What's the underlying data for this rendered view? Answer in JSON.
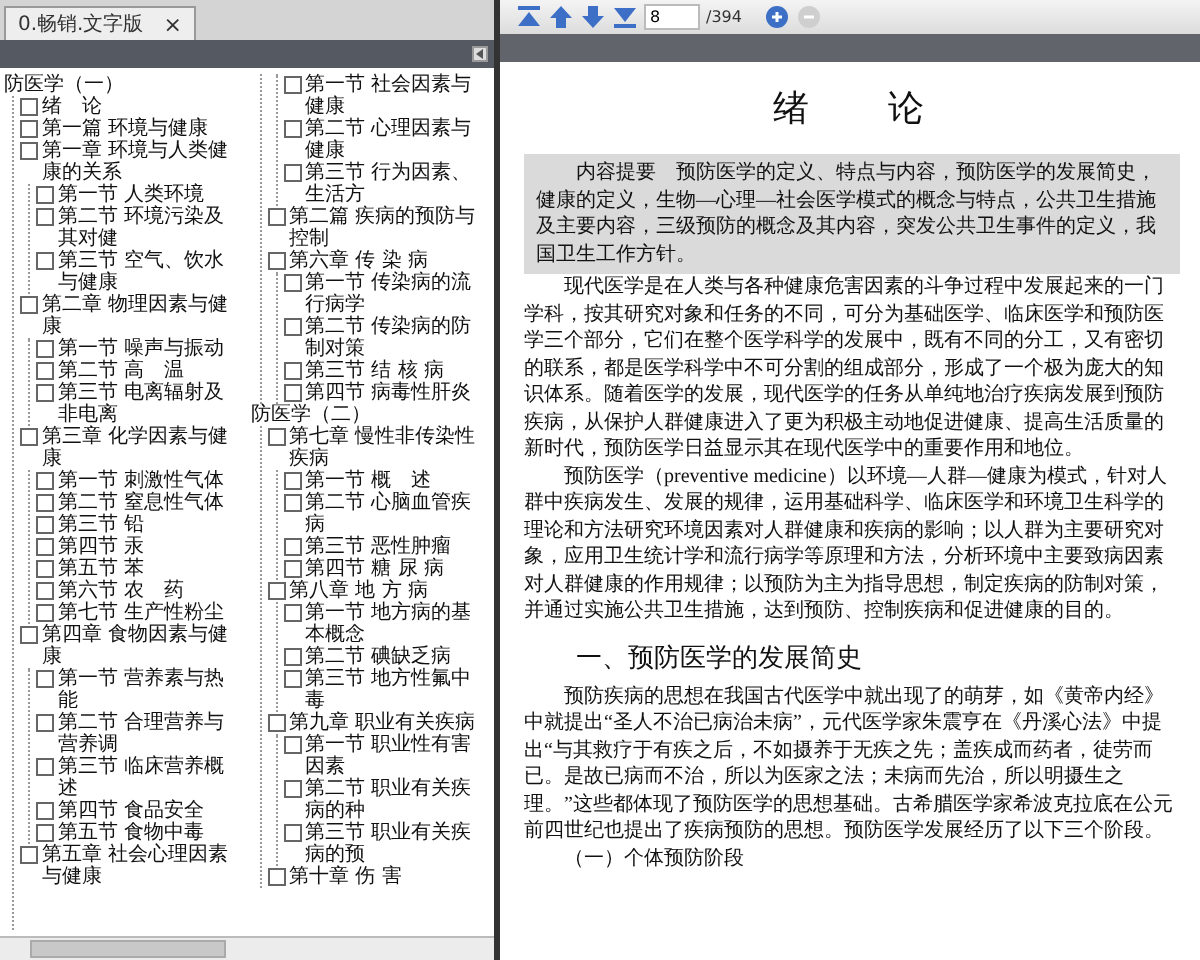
{
  "tab": {
    "label": "0.畅销.文字版",
    "close": "×"
  },
  "toolbar": {
    "page": "8",
    "total": "/394"
  },
  "sidebar": {
    "tree": [
      {
        "label": "防医学（一）",
        "children": [
          {
            "label": "绪　论",
            "checked": false
          },
          {
            "label": "第一篇 环境与健康",
            "checked": false
          },
          {
            "label": "第一章 环境与人类健康的关系",
            "checked": false,
            "children": [
              {
                "label": "第一节 人类环境",
                "checked": false
              },
              {
                "label": "第二节 环境污染及其对健",
                "checked": false
              },
              {
                "label": "第三节 空气、饮水与健康",
                "checked": false
              }
            ]
          },
          {
            "label": "第二章 物理因素与健康",
            "checked": false,
            "children": [
              {
                "label": "第一节 噪声与振动",
                "checked": false
              },
              {
                "label": "第二节 高　温",
                "checked": false
              },
              {
                "label": "第三节 电离辐射及非电离",
                "checked": false
              }
            ]
          },
          {
            "label": "第三章 化学因素与健康",
            "checked": false,
            "children": [
              {
                "label": "第一节 刺激性气体",
                "checked": false
              },
              {
                "label": "第二节 窒息性气体",
                "checked": false
              },
              {
                "label": "第三节 铅",
                "checked": false
              },
              {
                "label": "第四节 汞",
                "checked": false
              },
              {
                "label": "第五节 苯",
                "checked": false
              },
              {
                "label": "第六节 农　药",
                "checked": false
              },
              {
                "label": "第七节 生产性粉尘",
                "checked": false
              }
            ]
          },
          {
            "label": "第四章 食物因素与健康",
            "checked": false,
            "children": [
              {
                "label": "第一节 营养素与热能",
                "checked": false
              },
              {
                "label": "第二节 合理营养与营养调",
                "checked": false
              },
              {
                "label": "第三节 临床营养概述",
                "checked": false
              },
              {
                "label": "第四节 食品安全",
                "checked": false
              },
              {
                "label": "第五节 食物中毒",
                "checked": false
              }
            ]
          },
          {
            "label": "第五章 社会心理因素与健康",
            "checked": false,
            "children": [
              {
                "label": "第一节 社会因素与健康",
                "checked": false
              },
              {
                "label": "第二节 心理因素与健康",
                "checked": false
              },
              {
                "label": "第三节 行为因素、生活方",
                "checked": false
              }
            ]
          },
          {
            "label": "第二篇 疾病的预防与控制",
            "checked": false
          },
          {
            "label": "第六章 传 染 病",
            "checked": false,
            "children": [
              {
                "label": "第一节 传染病的流行病学",
                "checked": false
              },
              {
                "label": "第二节 传染病的防制对策",
                "checked": false
              },
              {
                "label": "第三节 结 核 病",
                "checked": false
              },
              {
                "label": "第四节 病毒性肝炎",
                "checked": false
              }
            ]
          }
        ]
      },
      {
        "label": "防医学（二）",
        "children": [
          {
            "label": "第七章 慢性非传染性疾病",
            "checked": false,
            "children": [
              {
                "label": "第一节 概　述",
                "checked": false
              },
              {
                "label": "第二节 心脑血管疾病",
                "checked": false
              },
              {
                "label": "第三节 恶性肿瘤",
                "checked": false
              },
              {
                "label": "第四节 糖 尿 病",
                "checked": false
              }
            ]
          },
          {
            "label": "第八章 地 方 病",
            "checked": false,
            "children": [
              {
                "label": "第一节 地方病的基本概念",
                "checked": false
              },
              {
                "label": "第二节 碘缺乏病",
                "checked": false
              },
              {
                "label": "第三节 地方性氟中毒",
                "checked": false
              }
            ]
          },
          {
            "label": "第九章 职业有关疾病",
            "checked": false,
            "children": [
              {
                "label": "第一节 职业性有害因素",
                "checked": false
              },
              {
                "label": "第二节 职业有关疾病的种",
                "checked": false
              },
              {
                "label": "第三节 职业有关疾病的预",
                "checked": false
              }
            ]
          },
          {
            "label": "第十章 伤 害",
            "checked": false
          }
        ]
      }
    ]
  },
  "document": {
    "blocks": [
      {
        "kind": "title",
        "text": "绪论"
      },
      {
        "kind": "abstract",
        "text": "内容提要　预防医学的定义、特点与内容，预防医学的发展简史，健康的定义，生物—心理—社会医学模式的概念与特点，公共卫生措施及主要内容，三级预防的概念及其内容，突发公共卫生事件的定义，我国卫生工作方针。"
      },
      {
        "kind": "paragraph",
        "text": "现代医学是在人类与各种健康危害因素的斗争过程中发展起来的一门学科，按其研究对象和任务的不同，可分为基础医学、临床医学和预防医学三个部分，它们在整个医学科学的发展中，既有不同的分工，又有密切的联系，都是医学科学中不可分割的组成部分，形成了一个极为庞大的知识体系。随着医学的发展，现代医学的任务从单纯地治疗疾病发展到预防疾病，从保护人群健康进入了更为积极主动地促进健康、提高生活质量的新时代，预防医学日益显示其在现代医学中的重要作用和地位。"
      },
      {
        "kind": "paragraph",
        "text": "预防医学（preventive medicine）以环境—人群—健康为模式，针对人群中疾病发生、发展的规律，运用基础科学、临床医学和环境卫生科学的理论和方法研究环境因素对人群健康和疾病的影响；以人群为主要研究对象，应用卫生统计学和流行病学等原理和方法，分析环境中主要致病因素对人群健康的作用规律；以预防为主为指导思想，制定疾病的防制对策，并通过实施公共卫生措施，达到预防、控制疾病和促进健康的目的。"
      },
      {
        "kind": "heading",
        "text": "一、预防医学的发展简史"
      },
      {
        "kind": "paragraph",
        "text": "预防疾病的思想在我国古代医学中就出现了的萌芽，如《黄帝内经》中就提出“圣人不治已病治未病”，元代医学家朱震亨在《丹溪心法》中提出“与其救疗于有疾之后，不如摄养于无疾之先；盖疾成而药者，徒劳而已。是故已病而不治，所以为医家之法；未病而先治，所以明摄生之理。”这些都体现了预防医学的思想基础。古希腊医学家希波克拉底在公元前四世纪也提出了疾病预防的思想。预防医学发展经历了以下三个阶段。"
      },
      {
        "kind": "subheading",
        "text": "（一）个体预防阶段"
      }
    ]
  }
}
